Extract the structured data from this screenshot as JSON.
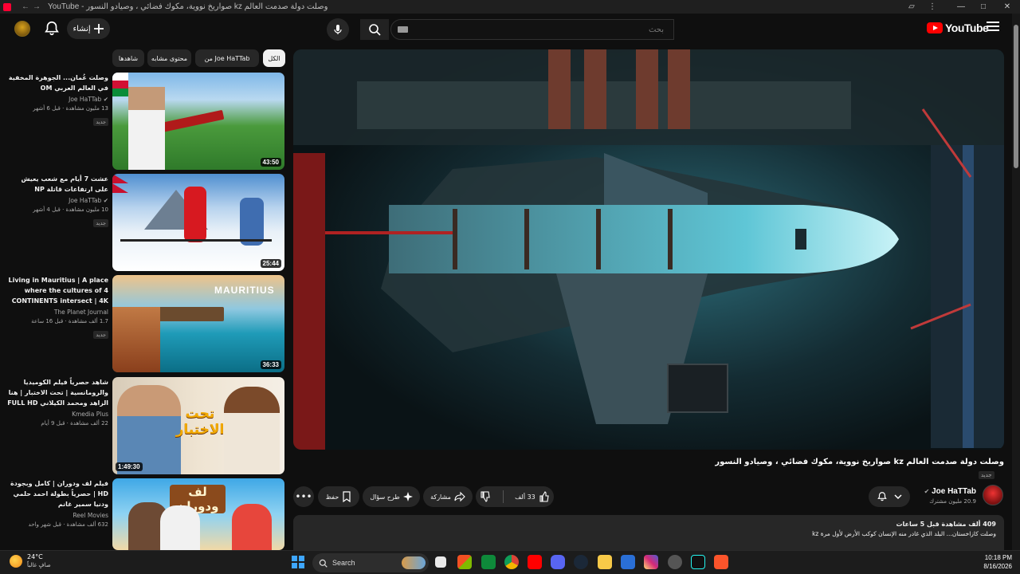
{
  "window": {
    "title": "YouTube - صواريخ نووية، مكوك فضائي ، وصيادو النسور kz وصلت دولة صدمت العالم",
    "controls": [
      "minimize",
      "maximize",
      "close"
    ]
  },
  "header": {
    "logo_text": "YouTube",
    "search_placeholder": "بحث",
    "create_label": "إنشاء",
    "icons": [
      "menu-icon",
      "search-icon",
      "mic-icon",
      "plus-icon",
      "bell-icon"
    ]
  },
  "chips": [
    {
      "label": "الكل",
      "active": true
    },
    {
      "label": "من Joe HaTTab",
      "active": false
    },
    {
      "label": "محتوى مشابه",
      "active": false
    },
    {
      "label": "شاهدها",
      "active": false
    }
  ],
  "recommendations": [
    {
      "title": "وصلت عُمان... الجوهرة المخفية في العالم العربي OM",
      "channel": "Joe HaTTab",
      "verified": true,
      "stats": "13 مليون مشاهدة · قبل 6 أشهر",
      "badge": "جديد",
      "duration": "43:50",
      "thumb_text": ""
    },
    {
      "title": "عشت 7 أيام مع شعب يعيش على ارتفاعات قاتلة NP",
      "channel": "Joe HaTTab",
      "verified": true,
      "stats": "10 مليون مشاهدة · قبل 4 أشهر",
      "badge": "جديد",
      "duration": "25:44",
      "thumb_text": ""
    },
    {
      "title": "Living in Mauritius | A place where the cultures of 4 CONTINENTS intersect | 4K ...",
      "channel": "The Planet Journal",
      "verified": false,
      "stats": "1.7 ألف مشاهدة · قبل 16 ساعة",
      "badge": "جديد",
      "duration": "36:33",
      "thumb_text": "MAURITIUS"
    },
    {
      "title": "شاهد حصرياً فيلم الكوميديا والرومانسية | تحت الاختبار | هنا الزاهد ومحمد الكيلاني FULL HD",
      "channel": "Kmedia Plus",
      "verified": false,
      "stats": "22 ألف مشاهدة · قبل 9 أيام",
      "badge": "",
      "duration": "1:49:30",
      "thumb_text": "تحت الاختبار"
    },
    {
      "title": "فيلم لف ودوران | كامل وبجودة HD | حصرياً بطولة احمد حلمي ودنيا سمير غانم",
      "channel": "Reel Movies",
      "verified": false,
      "stats": "632 ألف مشاهدة · قبل شهر واحد",
      "badge": "",
      "duration": "",
      "thumb_text": "لف ودوران"
    }
  ],
  "video": {
    "title": "وصلت دولة صدمت العالم kz صواريخ نووية، مكوك فضائي ، وصيادو النسور",
    "badge": "جديد",
    "channel": {
      "name": "Joe HaTTab",
      "verified": true,
      "subscribers": "20.9 مليون مشترك"
    },
    "actions": {
      "likes": "33 ألف",
      "share": "مشاركة",
      "ask": "طرح سؤال",
      "save": "حفظ"
    },
    "description": {
      "stats": "409 ألف مشاهدة  قبل 5 ساعات",
      "text": "وصلت كازاخستان... البلد الذي غادر منه الإنسان كوكب الأرض لأول مرة kz"
    }
  },
  "taskbar": {
    "weather_temp": "24°C",
    "weather_desc": "صافٍ غالباً",
    "search_label": "Search",
    "time": "10:18 PM",
    "date": "8/16/2026"
  },
  "colors": {
    "background": "#0f0f0f",
    "surface": "#272727",
    "text": "#f1f1f1",
    "muted": "#aaaaaa",
    "brand_red": "#ff0000"
  }
}
